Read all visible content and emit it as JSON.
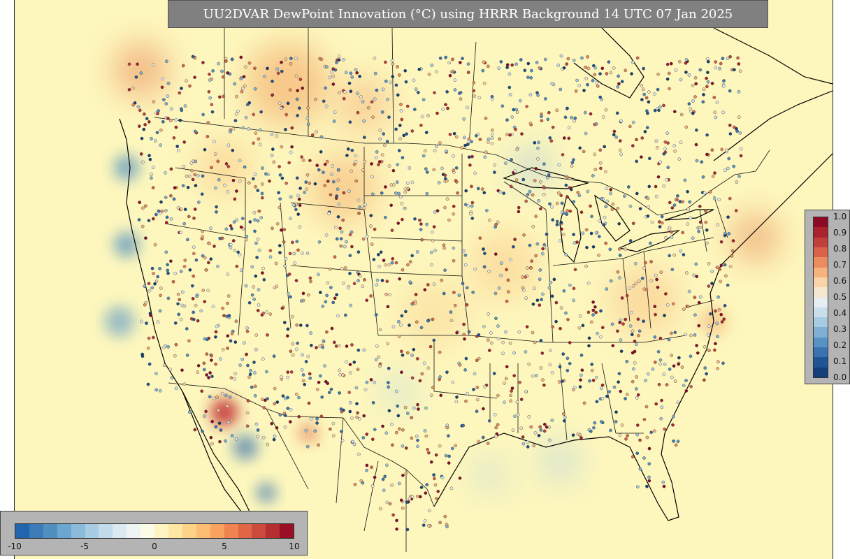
{
  "title": "UU2DVAR DewPoint Innovation (°C) using HRRR Background 14 UTC 07 Jan 2025",
  "map": {
    "background_color": "#fdf7bd",
    "coastline_color": "#000000",
    "boundary_color": "#111111"
  },
  "innovation_colorbar": {
    "ticks": [
      "-10",
      "-5",
      "0",
      "5",
      "10"
    ],
    "colors": [
      "#2166ac",
      "#3a7bb8",
      "#5090c0",
      "#6ba6d0",
      "#8bbadb",
      "#a8cce3",
      "#c2dbeb",
      "#dbe9f2",
      "#eef4f2",
      "#fbfbe7",
      "#fff4c2",
      "#fee7a3",
      "#fdd38a",
      "#fcbc72",
      "#f9a15f",
      "#f0834f",
      "#e06646",
      "#cc4a3c",
      "#b52f31",
      "#990f26"
    ]
  },
  "obs_colorbar": {
    "ticks": [
      "1.0",
      "0.9",
      "0.8",
      "0.7",
      "0.6",
      "0.5",
      "0.4",
      "0.3",
      "0.2",
      "0.1",
      "0.0"
    ],
    "colors": [
      "#8c0a26",
      "#a8232e",
      "#c1403a",
      "#d8634a",
      "#ea8c5e",
      "#f5b47f",
      "#f8d4a8",
      "#f3e7cf",
      "#e6eef2",
      "#c9dfec",
      "#a6cbe2",
      "#7fb0d4",
      "#5892c4",
      "#3a74b0",
      "#1f5597",
      "#123f7a"
    ]
  }
}
